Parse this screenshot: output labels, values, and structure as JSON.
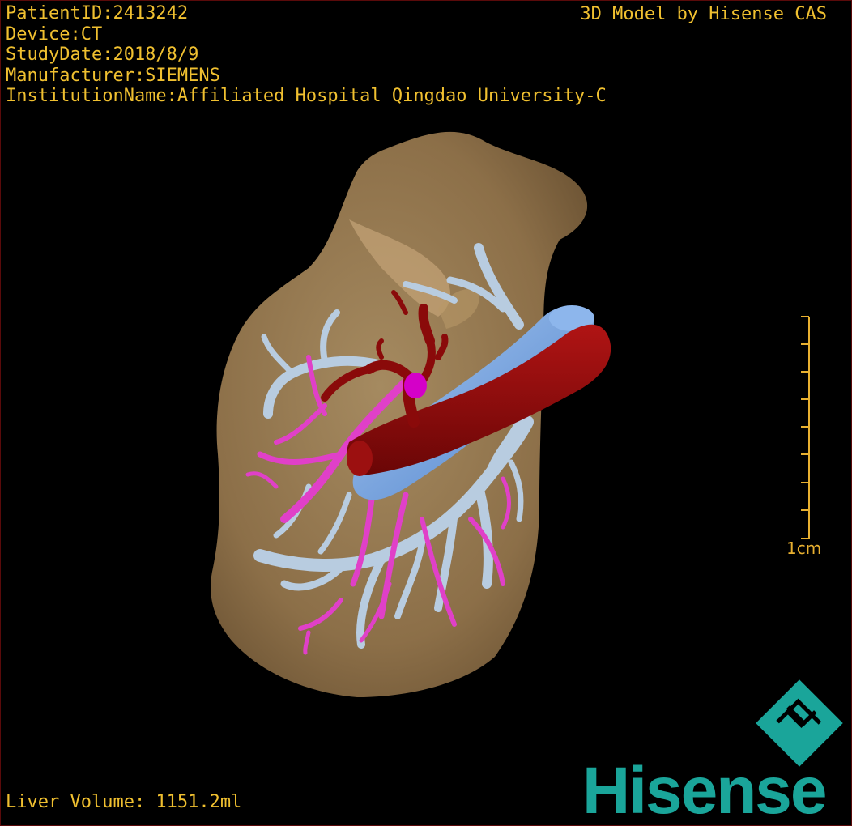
{
  "viewer": {
    "metadata": {
      "patient_id": "PatientID:2413242",
      "device": "Device:CT",
      "study_date": "StudyDate:2018/8/9",
      "manufacturer": "Manufacturer:SIEMENS",
      "institution": "InstitutionName:Affiliated Hospital Qingdao University-C"
    },
    "credit": "3D Model by Hisense CAS",
    "liver_volume": "Liver Volume: 1151.2ml",
    "scale_label": "1cm",
    "brand": "Hisense"
  },
  "colors": {
    "overlay_text": "#f0c030",
    "liver": "#8c6f48",
    "portal_vein": "#b4c8dc",
    "hepatic_vein": "#e040c8",
    "artery": "#8a0a0a",
    "vena_cava": "#78a8e0",
    "brand": "#1aa59a",
    "scale": "#e8b030"
  },
  "icons": [
    "hisense-logo-icon",
    "scale-bar-icon"
  ]
}
